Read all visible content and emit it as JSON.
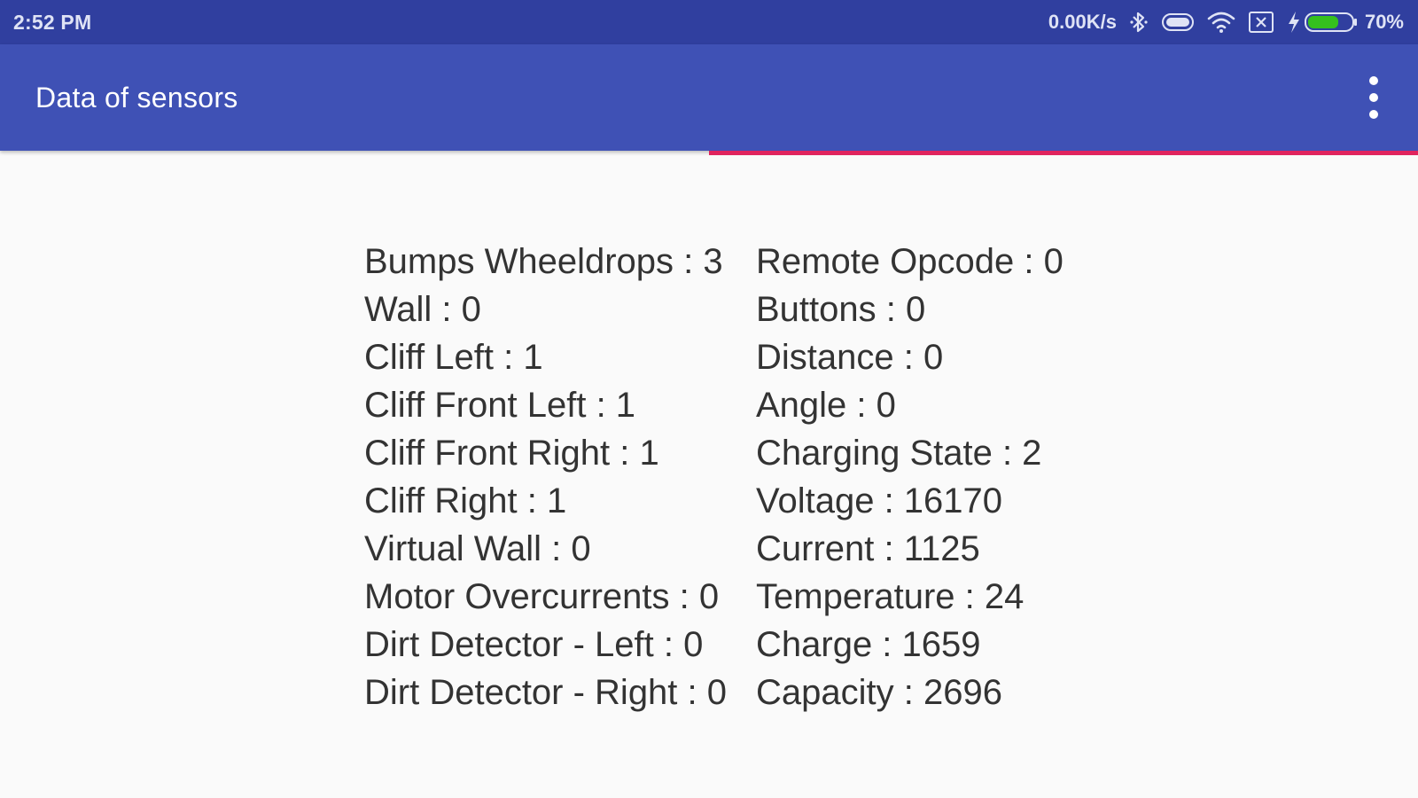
{
  "status_bar": {
    "time": "2:52 PM",
    "net_speed": "0.00K/s",
    "battery_percent": "70%",
    "battery_level": 0.7,
    "icons": [
      "bluetooth-icon",
      "toggle-icon",
      "wifi-icon",
      "no-sim-icon",
      "charging-icon",
      "battery-icon"
    ]
  },
  "app_bar": {
    "title": "Data of sensors",
    "menu_icon": "more-vert-icon",
    "accent_color": "#e0245e",
    "primary_color": "#3f51b5",
    "status_color": "#303f9f"
  },
  "sensors": {
    "left": [
      "Bumps Wheeldrops : 3",
      "Wall : 0",
      "Cliff Left : 1",
      "Cliff Front Left : 1",
      "Cliff Front Right : 1",
      "Cliff Right : 1",
      "Virtual Wall : 0",
      "Motor Overcurrents : 0",
      "Dirt Detector - Left : 0",
      "Dirt Detector - Right : 0"
    ],
    "right": [
      "Remote Opcode : 0",
      "Buttons : 0",
      "Distance : 0",
      "Angle : 0",
      "Charging State : 2",
      "Voltage : 16170",
      "Current : 1125",
      "Temperature : 24",
      "Charge : 1659",
      "Capacity : 2696"
    ]
  }
}
